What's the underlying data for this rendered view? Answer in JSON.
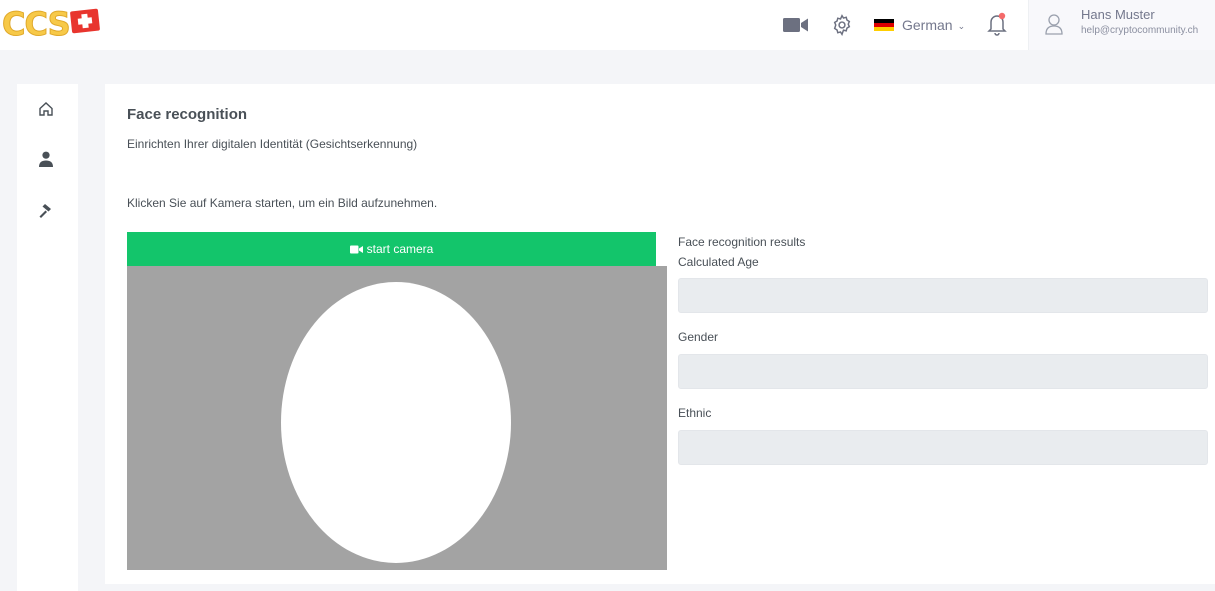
{
  "header": {
    "logo_text": "CCS",
    "language": {
      "selected": "German",
      "flag_colors": [
        "#000000",
        "#dd0000",
        "#ffce00"
      ]
    },
    "user": {
      "name": "Hans Muster",
      "email": "help@cryptocommunity.ch"
    },
    "notification_dot_color": "#f46a6a"
  },
  "sidebar": {
    "items": [
      {
        "icon": "home-icon"
      },
      {
        "icon": "user-icon"
      },
      {
        "icon": "hammer-icon"
      }
    ]
  },
  "main": {
    "title": "Face recognition",
    "subtitle": "Einrichten Ihrer digitalen Identität (Gesichtserkennung)",
    "instruction": "Klicken Sie auf Kamera starten, um ein Bild aufzunehmen.",
    "start_camera_label": "start camera",
    "button_color": "#13c56b",
    "results": {
      "heading": "Face recognition results",
      "fields": [
        {
          "label": "Calculated Age",
          "value": ""
        },
        {
          "label": "Gender",
          "value": ""
        },
        {
          "label": "Ethnic",
          "value": ""
        }
      ]
    }
  }
}
